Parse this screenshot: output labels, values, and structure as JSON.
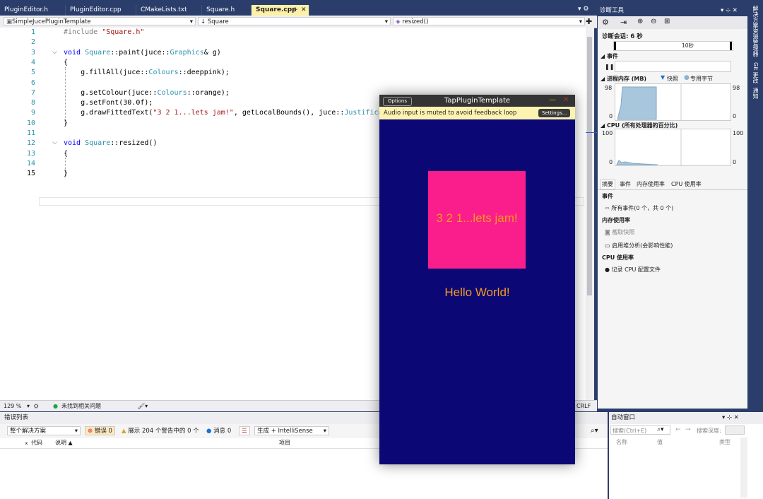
{
  "editor_tabs": [
    {
      "label": "PluginEditor.h"
    },
    {
      "label": "PluginEditor.cpp"
    },
    {
      "label": "CMakeLists.txt"
    },
    {
      "label": "Square.h"
    },
    {
      "label": "Square.cpp",
      "active": true
    }
  ],
  "nav": {
    "project": "SimpleJucePluginTemplate",
    "scope": "Square",
    "member": "resized()"
  },
  "code_lines": [
    {
      "n": "1",
      "text": "#include \"Square.h\""
    },
    {
      "n": "2",
      "text": ""
    },
    {
      "n": "3",
      "text": "void Square::paint(juce::Graphics& g)"
    },
    {
      "n": "4",
      "text": "{"
    },
    {
      "n": "5",
      "text": "    g.fillAll(juce::Colours::deeppink);"
    },
    {
      "n": "6",
      "text": ""
    },
    {
      "n": "7",
      "text": "    g.setColour(juce::Colours::orange);"
    },
    {
      "n": "8",
      "text": "    g.setFont(30.0f);"
    },
    {
      "n": "9",
      "text": "    g.drawFittedText(\"3 2 1...lets jam!\", getLocalBounds(), juce::Justificati"
    },
    {
      "n": "10",
      "text": "}"
    },
    {
      "n": "11",
      "text": ""
    },
    {
      "n": "12",
      "text": "void Square::resized()"
    },
    {
      "n": "13",
      "text": "{"
    },
    {
      "n": "14",
      "text": ""
    },
    {
      "n": "15",
      "text": "}"
    }
  ],
  "status": {
    "zoom": "129 %",
    "issues": "未找到相关问题",
    "line_ending": "CRLF"
  },
  "error_list": {
    "title": "错误列表",
    "scope": "整个解决方案",
    "errors": "错误 0",
    "warnings": "展示 204 个警告中的 0 个",
    "messages": "消息 0",
    "build_filter": "生成 + IntelliSense",
    "col_code": "代码",
    "col_desc": "说明",
    "col_project": "项目"
  },
  "immediate": {
    "title": "自动窗口",
    "search_placeholder": "搜索(Ctrl+E)",
    "search_depth": "搜索深度:",
    "col_name": "名称",
    "col_value": "值",
    "col_type": "类型"
  },
  "diagnostics": {
    "title": "诊断工具",
    "session": "诊断会话: 6 秒",
    "timeline_label": "10秒",
    "events_section": "事件",
    "memory_section": "进程内存 (MB)",
    "snapshot_legend": "快照",
    "private_bytes_legend": "专用字节",
    "mem_max": "98",
    "mem_min": "0",
    "cpu_section": "CPU (所有处理器的百分比)",
    "cpu_max": "100",
    "cpu_min": "0",
    "tabs": [
      "摘要",
      "事件",
      "内存使用率",
      "CPU 使用率"
    ],
    "events_heading": "事件",
    "all_events": "所有事件(0 个，共 0 个)",
    "memory_heading": "内存使用率",
    "take_snapshot": "截取快照",
    "enable_heap": "启用堆分析(会影响性能)",
    "cpu_heading": "CPU 使用率",
    "record_cpu": "记录 CPU 配置文件"
  },
  "right_strip": [
    "解决方案资源管理器",
    "Git 更改",
    "通知"
  ],
  "plugin": {
    "options": "Options",
    "title": "TapPluginTemplate",
    "warning": "Audio input is muted to avoid feedback loop",
    "settings": "Settings...",
    "square_text": "3 2 1...lets jam!",
    "hello": "Hello World!",
    "bg_color": "#0b0876",
    "square_color": "#fa1d8c",
    "text_color": "#f59b1c"
  }
}
